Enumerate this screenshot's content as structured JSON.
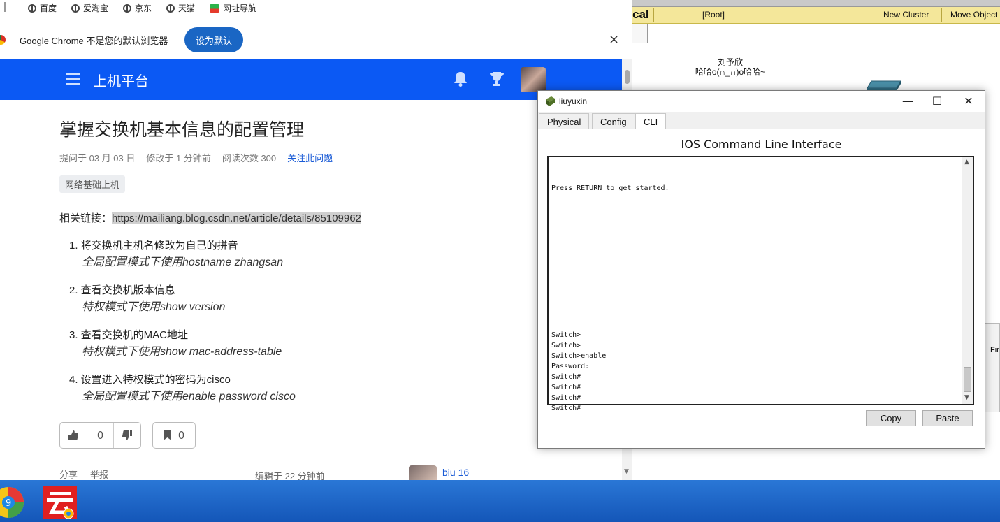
{
  "browser": {
    "bookmarks": [
      "百度",
      "爱淘宝",
      "京东",
      "天猫",
      "网址导航"
    ],
    "infobar": {
      "text": "Google Chrome 不是您的默认浏览器",
      "button": "设为默认",
      "close": "×"
    },
    "header": {
      "site_title": "上机平台"
    },
    "question": {
      "title": "掌握交换机基本信息的配置管理",
      "meta": [
        "提问于 03 月 03 日",
        "修改于 1 分钟前",
        "阅读次数 300"
      ],
      "follow": "关注此问题",
      "tag": "网络基础上机",
      "link_label": "相关链接：",
      "link_url": "https://mailiang.blog.csdn.net/article/details/85109962",
      "steps": [
        {
          "main": "1. 将交换机主机名修改为自己的拼音",
          "sub": "全局配置模式下使用hostname zhangsan"
        },
        {
          "main": "2. 查看交换机版本信息",
          "sub": "特权模式下使用show version"
        },
        {
          "main": "3. 查看交换机的MAC地址",
          "sub": "特权模式下使用show mac-address-table"
        },
        {
          "main": "4. 设置进入特权模式的密码为cisco",
          "sub": "全局配置模式下使用enable password cisco"
        }
      ],
      "votes": "0",
      "bookmarks": "0"
    },
    "footer": {
      "share": "分享",
      "report": "举报",
      "edited": "编辑于 22 分钟前",
      "author": "biu 16"
    }
  },
  "packet_tracer": {
    "mode": "cal",
    "root": "[Root]",
    "new_cluster": "New Cluster",
    "move_object": "Move Object",
    "device_label_line1": "刘予欣",
    "device_label_line2": "哈哈o(∩_∩)o哈哈~",
    "side_panel_text": "Fir"
  },
  "dialog": {
    "title": "liuyuxin",
    "tabs": [
      "Physical",
      "Config",
      "CLI"
    ],
    "active_tab": "CLI",
    "heading": "IOS Command Line Interface",
    "terminal_text": "\nPress RETURN to get started.\n\n\n\n\n\n\n\n\n\n\n\n\n\nSwitch>\nSwitch>\nSwitch>enable\nPassword:\nSwitch#\nSwitch#\nSwitch#\nSwitch#",
    "copy": "Copy",
    "paste": "Paste"
  }
}
